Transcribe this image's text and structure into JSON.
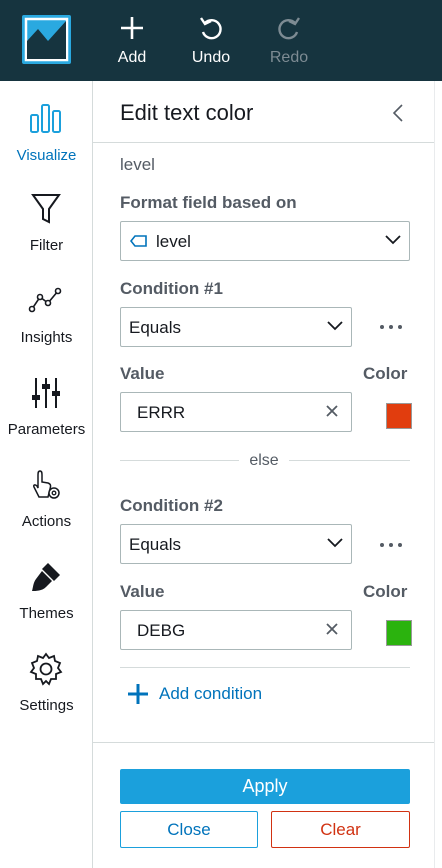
{
  "toolbar": {
    "add_label": "Add",
    "undo_label": "Undo",
    "redo_label": "Redo"
  },
  "leftnav": {
    "items": [
      {
        "label": "Visualize",
        "icon": "bar-chart-icon",
        "active": true
      },
      {
        "label": "Filter",
        "icon": "funnel-icon"
      },
      {
        "label": "Insights",
        "icon": "trend-line-icon"
      },
      {
        "label": "Parameters",
        "icon": "sliders-icon"
      },
      {
        "label": "Actions",
        "icon": "pointer-gear-icon"
      },
      {
        "label": "Themes",
        "icon": "paintbrush-icon"
      },
      {
        "label": "Settings",
        "icon": "gear-icon"
      }
    ]
  },
  "panel": {
    "title": "Edit text color",
    "field_name": "level",
    "format_based_on_label": "Format field based on",
    "format_based_on_value": "level",
    "else_label": "else",
    "add_condition_label": "Add condition",
    "apply_label": "Apply",
    "close_label": "Close",
    "clear_label": "Clear",
    "conditions": [
      {
        "title": "Condition #1",
        "operator": "Equals",
        "value_label": "Value",
        "color_label": "Color",
        "value": "ERRR",
        "color": "#e13d0e"
      },
      {
        "title": "Condition #2",
        "operator": "Equals",
        "value_label": "Value",
        "color_label": "Color",
        "value": "DEBG",
        "color": "#2bb30e"
      }
    ]
  },
  "colors": {
    "topbar": "#16343f",
    "accent": "#1ba0dc",
    "link": "#0073bb",
    "danger": "#d13212"
  }
}
